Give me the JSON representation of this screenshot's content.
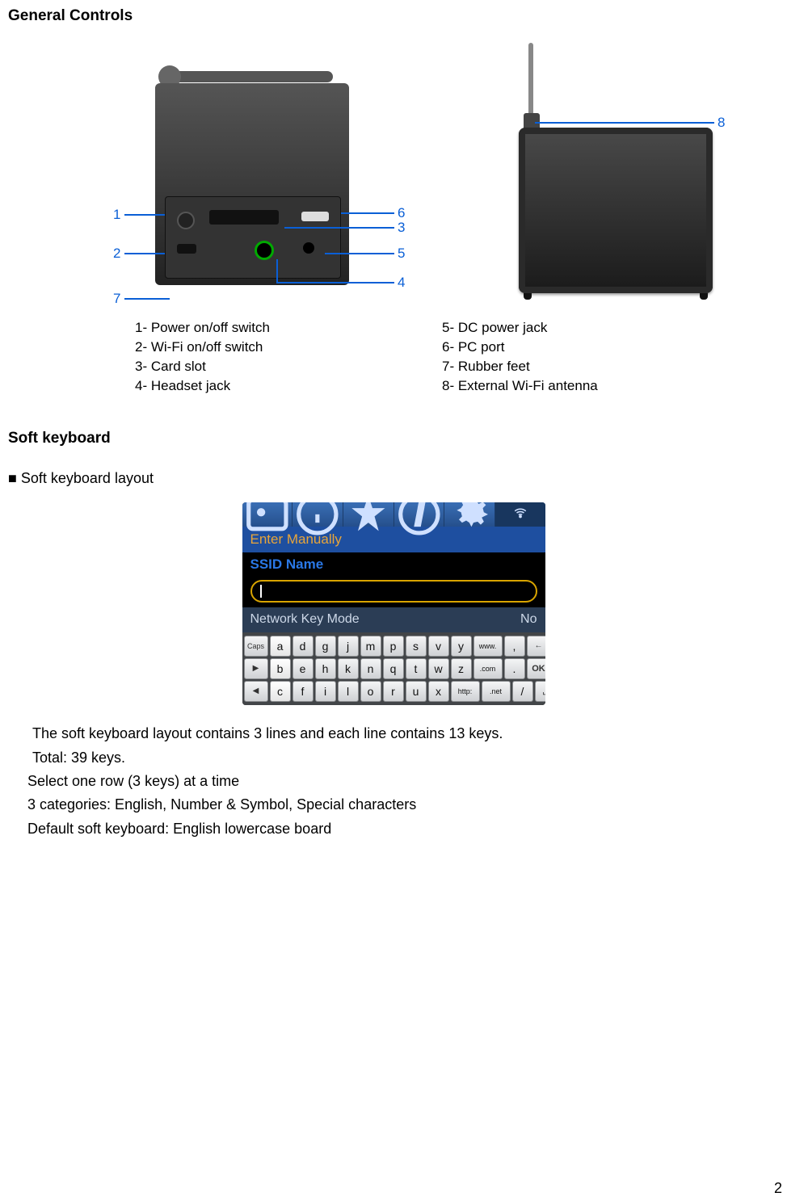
{
  "headings": {
    "general_controls": "General Controls",
    "soft_keyboard": "Soft keyboard",
    "soft_keyboard_layout": "Soft keyboard layout"
  },
  "callouts": {
    "n1": "1",
    "n2": "2",
    "n3": "3",
    "n4": "4",
    "n5": "5",
    "n6": "6",
    "n7": "7",
    "n8": "8"
  },
  "legend": {
    "l1": "1- Power on/off switch",
    "l2": "2- Wi-Fi on/off switch",
    "l3": "3- Card slot",
    "l4": "4- Headset jack",
    "l5": "5- DC power jack",
    "l6": "6- PC port",
    "l7": "7- Rubber feet",
    "l8": "8- External Wi-Fi antenna"
  },
  "screenshot": {
    "title": "Enter Manually",
    "ssid_label": "SSID Name",
    "mode_label": "Network Key Mode",
    "mode_value": "No",
    "keys_row1_side": "Caps",
    "keys_row2_side": "▶",
    "keys_row3_side": "◀",
    "row1": [
      "a",
      "d",
      "g",
      "j",
      "m",
      "p",
      "s",
      "v",
      "y"
    ],
    "row1_extra": [
      "www.",
      ","
    ],
    "row1_end": "←",
    "row2": [
      "b",
      "e",
      "h",
      "k",
      "n",
      "q",
      "t",
      "w",
      "z"
    ],
    "row2_extra": [
      ".com",
      "."
    ],
    "row2_end": "OK",
    "row3": [
      "c",
      "f",
      "i",
      "l",
      "o",
      "r",
      "u",
      "x"
    ],
    "row3_extra": [
      "http:",
      ".net",
      "/"
    ],
    "row3_end": "␣"
  },
  "body": {
    "p1": "The soft keyboard layout contains 3 lines and each line contains 13 keys.",
    "p2": "Total: 39 keys.",
    "p3": "Select one row (3 keys) at a time",
    "p4": "3 categories: English, Number & Symbol, Special characters",
    "p5": "Default soft keyboard: English lowercase board"
  },
  "page_number": "2"
}
